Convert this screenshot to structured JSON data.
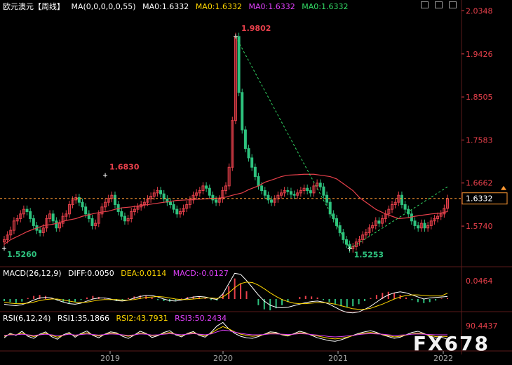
{
  "header": {
    "symbol": "欧元澳元【周线】",
    "ma_params": "MA(0,0,0,0,0,55)",
    "ma_values": [
      "MA0:1.6332",
      "MA0:1.6332",
      "MA0:1.6332",
      "MA0:1.6332"
    ],
    "ma_colors": [
      "#ffffff",
      "#ffd700",
      "#e040fb",
      "#33dd66"
    ]
  },
  "macd_header": {
    "params": "MACD(26,12,9)",
    "diff": "DIFF:0.0050",
    "dea": "DEA:0.0114",
    "macd": "MACD:-0.0127"
  },
  "rsi_header": {
    "params": "RSI(6,12,24)",
    "rsi1": "RSI1:35.1866",
    "rsi2": "RSI2:43.7931",
    "rsi3": "RSI3:50.2434"
  },
  "watermark": "FX678",
  "colors": {
    "up": "#e8404b",
    "down": "#2ec27e",
    "ma": "#e8404b",
    "dashed": "#ff9933",
    "trend": "#33dd66",
    "axis_text": "#e8404b",
    "grid": "#2a1010"
  },
  "chart_data": {
    "type": "candlestick",
    "title": "欧元澳元【周线】",
    "y_ticks": [
      "2.0348",
      "1.9426",
      "1.8505",
      "1.7583",
      "1.6662",
      "1.5740"
    ],
    "y_range": [
      1.49,
      2.04
    ],
    "x_labels": [
      "2019",
      "2020",
      "2021",
      "2022"
    ],
    "current_price": "1.6332",
    "annotations": [
      {
        "label": "1.9802",
        "value": 1.9802,
        "color": "#e8404b"
      },
      {
        "label": "1.6830",
        "value": 1.683,
        "color": "#e8404b"
      },
      {
        "label": "1.5260",
        "value": 1.526,
        "color": "#2ec27e"
      },
      {
        "label": "1.5253",
        "value": 1.5253,
        "color": "#2ec27e"
      }
    ],
    "close_series": [
      1.545,
      1.555,
      1.565,
      1.585,
      1.59,
      1.6,
      1.61,
      1.605,
      1.59,
      1.575,
      1.565,
      1.56,
      1.57,
      1.59,
      1.6,
      1.585,
      1.57,
      1.58,
      1.595,
      1.6,
      1.62,
      1.63,
      1.635,
      1.625,
      1.615,
      1.6,
      1.59,
      1.575,
      1.58,
      1.6,
      1.615,
      1.625,
      1.633,
      1.64,
      1.62,
      1.605,
      1.595,
      1.585,
      1.59,
      1.605,
      1.61,
      1.615,
      1.62,
      1.625,
      1.632,
      1.638,
      1.645,
      1.65,
      1.643,
      1.632,
      1.625,
      1.62,
      1.61,
      1.6,
      1.605,
      1.612,
      1.62,
      1.63,
      1.64,
      1.645,
      1.65,
      1.66,
      1.655,
      1.64,
      1.63,
      1.625,
      1.632,
      1.65,
      1.66,
      1.7,
      1.8,
      1.98,
      1.86,
      1.78,
      1.74,
      1.72,
      1.7,
      1.68,
      1.66,
      1.65,
      1.64,
      1.63,
      1.625,
      1.632,
      1.64,
      1.645,
      1.65,
      1.648,
      1.642,
      1.64,
      1.645,
      1.65,
      1.655,
      1.65,
      1.645,
      1.66,
      1.666,
      1.658,
      1.64,
      1.625,
      1.6,
      1.59,
      1.575,
      1.56,
      1.545,
      1.535,
      1.5253,
      1.53,
      1.54,
      1.545,
      1.555,
      1.56,
      1.57,
      1.575,
      1.585,
      1.58,
      1.59,
      1.6,
      1.61,
      1.62,
      1.625,
      1.64,
      1.62,
      1.61,
      1.6,
      1.585,
      1.575,
      1.57,
      1.58,
      1.57,
      1.575,
      1.585,
      1.59,
      1.595,
      1.6,
      1.612,
      1.633
    ],
    "ma55": [
      1.535,
      1.545,
      1.555,
      1.562,
      1.57,
      1.575,
      1.578,
      1.582,
      1.586,
      1.59,
      1.595,
      1.6,
      1.603,
      1.606,
      1.61,
      1.613,
      1.615,
      1.617,
      1.62,
      1.622,
      1.625,
      1.627,
      1.629,
      1.63,
      1.631,
      1.632,
      1.633,
      1.634,
      1.636,
      1.64,
      1.645,
      1.652,
      1.66,
      1.668,
      1.675,
      1.68,
      1.683,
      1.684,
      1.685,
      1.685,
      1.683,
      1.68,
      1.675,
      1.665,
      1.65,
      1.635,
      1.62,
      1.61,
      1.6,
      1.595,
      1.59,
      1.592,
      1.595,
      1.598,
      1.6,
      1.602,
      1.605
    ],
    "macd": {
      "ticks": [
        "0.0464"
      ],
      "hist": [
        -0.004,
        -0.006,
        -0.008,
        -0.005,
        0.002,
        0.006,
        0.008,
        0.006,
        0.002,
        -0.003,
        -0.006,
        -0.008,
        -0.006,
        -0.002,
        0.003,
        0.006,
        0.004,
        0.001,
        -0.002,
        -0.004,
        -0.003,
        0.002,
        0.005,
        0.007,
        0.006,
        0.003,
        -0.002,
        -0.004,
        -0.005,
        -0.003,
        0.001,
        0.004,
        0.005,
        0.004,
        0.002,
        -0.002,
        -0.003,
        0.01,
        0.025,
        0.04,
        0.03,
        0.015,
        0.0,
        -0.012,
        -0.02,
        -0.022,
        -0.018,
        -0.012,
        -0.006,
        0.0,
        0.004,
        0.006,
        0.005,
        0.003,
        -0.002,
        -0.006,
        -0.01,
        -0.014,
        -0.016,
        -0.014,
        -0.01,
        -0.004,
        0.002,
        0.008,
        0.012,
        0.014,
        0.012,
        0.008,
        0.003,
        -0.002,
        -0.006,
        -0.008,
        -0.006,
        -0.003,
        0.001,
        0.002
      ],
      "diff": [
        -0.01,
        -0.012,
        -0.013,
        -0.011,
        -0.007,
        -0.002,
        0.002,
        0.003,
        0.002,
        -0.002,
        -0.006,
        -0.009,
        -0.01,
        -0.008,
        -0.004,
        0.0,
        0.002,
        0.002,
        0.0,
        -0.003,
        -0.004,
        -0.002,
        0.002,
        0.005,
        0.007,
        0.007,
        0.004,
        0.0,
        -0.003,
        -0.004,
        -0.002,
        0.001,
        0.004,
        0.005,
        0.004,
        0.001,
        -0.001,
        0.01,
        0.03,
        0.05,
        0.048,
        0.036,
        0.022,
        0.008,
        -0.004,
        -0.012,
        -0.016,
        -0.017,
        -0.016,
        -0.013,
        -0.01,
        -0.007,
        -0.005,
        -0.004,
        -0.006,
        -0.01,
        -0.016,
        -0.022,
        -0.026,
        -0.027,
        -0.025,
        -0.02,
        -0.014,
        -0.006,
        0.002,
        0.008,
        0.012,
        0.014,
        0.012,
        0.008,
        0.004,
        0.0,
        0.002,
        0.003,
        0.004,
        0.005
      ],
      "dea": [
        -0.006,
        -0.008,
        -0.009,
        -0.009,
        -0.008,
        -0.006,
        -0.003,
        -0.001,
        0.0,
        0.0,
        -0.002,
        -0.004,
        -0.006,
        -0.007,
        -0.006,
        -0.004,
        -0.002,
        -0.001,
        -0.001,
        -0.001,
        -0.002,
        -0.002,
        -0.001,
        0.001,
        0.003,
        0.004,
        0.005,
        0.004,
        0.002,
        0.0,
        -0.001,
        -0.001,
        0.0,
        0.001,
        0.002,
        0.002,
        0.001,
        0.004,
        0.012,
        0.022,
        0.03,
        0.033,
        0.032,
        0.027,
        0.02,
        0.012,
        0.005,
        -0.001,
        -0.005,
        -0.008,
        -0.009,
        -0.009,
        -0.008,
        -0.007,
        -0.007,
        -0.008,
        -0.01,
        -0.013,
        -0.016,
        -0.019,
        -0.02,
        -0.02,
        -0.018,
        -0.014,
        -0.01,
        -0.005,
        0.0,
        0.004,
        0.007,
        0.008,
        0.008,
        0.007,
        0.006,
        0.006,
        0.006,
        0.0114
      ]
    },
    "rsi": {
      "ticks": [
        "90.4437"
      ],
      "rsi1": [
        40,
        55,
        48,
        62,
        45,
        38,
        52,
        60,
        44,
        35,
        50,
        58,
        42,
        55,
        63,
        48,
        40,
        52,
        60,
        57,
        45,
        38,
        49,
        62,
        55,
        41,
        47,
        58,
        64,
        50,
        43,
        55,
        61,
        48,
        42,
        58,
        80,
        92,
        70,
        55,
        45,
        40,
        38,
        44,
        52,
        60,
        58,
        50,
        46,
        54,
        62,
        57,
        48,
        40,
        35,
        30,
        28,
        33,
        40,
        48,
        55,
        60,
        64,
        58,
        50,
        44,
        38,
        42,
        50,
        58,
        62,
        55,
        45,
        38,
        42,
        35
      ],
      "rsi2": [
        45,
        52,
        50,
        56,
        49,
        44,
        50,
        55,
        48,
        42,
        48,
        54,
        47,
        52,
        57,
        50,
        46,
        51,
        56,
        54,
        49,
        45,
        49,
        56,
        53,
        47,
        49,
        54,
        58,
        52,
        48,
        53,
        57,
        51,
        47,
        55,
        68,
        78,
        70,
        60,
        52,
        48,
        45,
        47,
        51,
        56,
        55,
        51,
        49,
        52,
        57,
        55,
        50,
        46,
        42,
        38,
        36,
        38,
        42,
        47,
        52,
        56,
        58,
        55,
        51,
        47,
        43,
        45,
        49,
        53,
        56,
        53,
        48,
        44,
        45,
        44
      ],
      "rsi3": [
        48,
        50,
        50,
        52,
        50,
        48,
        50,
        52,
        50,
        47,
        49,
        52,
        49,
        51,
        53,
        51,
        49,
        51,
        53,
        52,
        50,
        48,
        50,
        53,
        52,
        49,
        50,
        52,
        54,
        52,
        50,
        52,
        54,
        52,
        50,
        53,
        60,
        66,
        64,
        59,
        55,
        52,
        50,
        50,
        51,
        53,
        53,
        52,
        51,
        52,
        54,
        53,
        51,
        49,
        47,
        44,
        43,
        44,
        46,
        48,
        51,
        53,
        54,
        53,
        52,
        50,
        48,
        49,
        50,
        52,
        53,
        52,
        51,
        50,
        50,
        50
      ]
    }
  }
}
